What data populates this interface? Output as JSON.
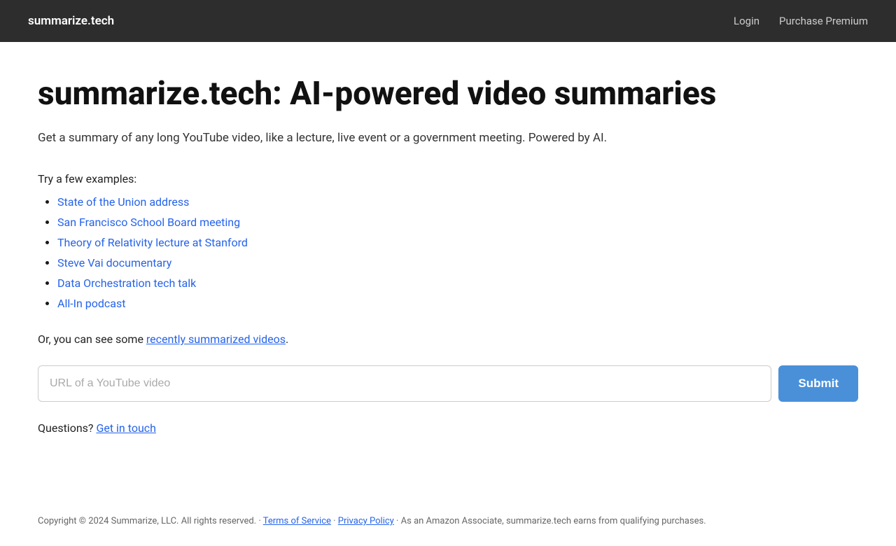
{
  "header": {
    "logo": "summarize.tech",
    "nav": {
      "login_label": "Login",
      "premium_label": "Purchase Premium"
    }
  },
  "main": {
    "title": "summarize.tech: AI-powered video summaries",
    "subtitle": "Get a summary of any long YouTube video, like a lecture, live event or a government meeting. Powered by AI.",
    "examples_label": "Try a few examples:",
    "examples": [
      {
        "label": "State of the Union address",
        "href": "#"
      },
      {
        "label": "San Francisco School Board meeting",
        "href": "#"
      },
      {
        "label": "Theory of Relativity lecture at Stanford",
        "href": "#"
      },
      {
        "label": "Steve Vai documentary",
        "href": "#"
      },
      {
        "label": "Data Orchestration tech talk",
        "href": "#"
      },
      {
        "label": "All-In podcast",
        "href": "#"
      }
    ],
    "recently_prefix": "Or, you can see some ",
    "recently_link": "recently summarized videos",
    "recently_suffix": ".",
    "url_placeholder": "URL of a YouTube video",
    "submit_label": "Submit",
    "questions_prefix": "Questions? ",
    "questions_link": "Get in touch"
  },
  "footer": {
    "copyright": "Copyright © 2024 Summarize, LLC. All rights reserved. · ",
    "tos_label": "Terms of Service",
    "separator1": " · ",
    "privacy_label": "Privacy Policy",
    "separator2": " · As an Amazon Associate, summarize.tech earns from qualifying purchases."
  }
}
